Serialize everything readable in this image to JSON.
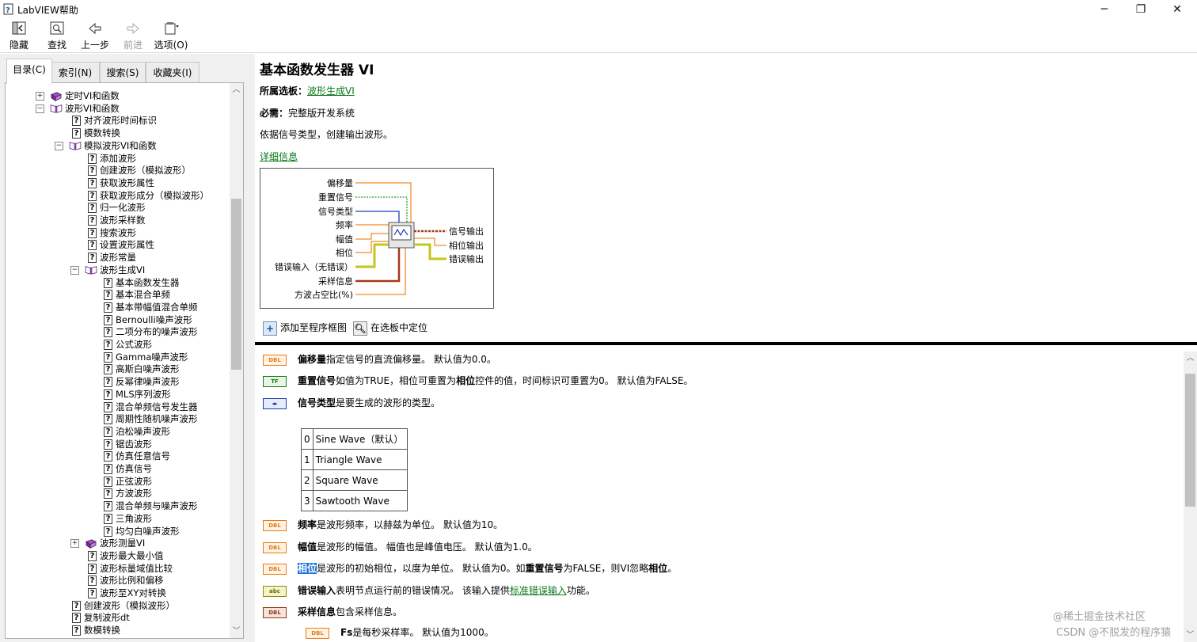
{
  "window": {
    "title": "LabVIEW帮助"
  },
  "toolbar": {
    "hide": "隐藏",
    "find": "查找",
    "back": "上一步",
    "forward": "前进",
    "options": "选项(O)"
  },
  "tabs": [
    "目录(C)",
    "索引(N)",
    "搜索(S)",
    "收藏夹(I)"
  ],
  "tree": [
    "定时VI和函数",
    "波形VI和函数",
    "对齐波形时间标识",
    "模数转换",
    "模拟波形VI和函数",
    "添加波形",
    "创建波形（模拟波形）",
    "获取波形属性",
    "获取波形成分（模拟波形）",
    "归一化波形",
    "波形采样数",
    "搜索波形",
    "设置波形属性",
    "波形常量",
    "波形生成VI",
    "基本函数发生器",
    "基本混合单频",
    "基本带幅值混合单频",
    "Bernoulli噪声波形",
    "二项分布的噪声波形",
    "公式波形",
    "Gamma噪声波形",
    "高斯白噪声波形",
    "反幂律噪声波形",
    "MLS序列波形",
    "混合单频信号发生器",
    "周期性随机噪声波形",
    "泊松噪声波形",
    "锯齿波形",
    "仿真任意信号",
    "仿真信号",
    "正弦波形",
    "方波波形",
    "混合单频与噪声波形",
    "三角波形",
    "均匀白噪声波形",
    "波形测量VI",
    "波形最大最小值",
    "波形标量域值比较",
    "波形比例和偏移",
    "波形至XY对转换",
    "创建波形（模拟波形）",
    "复制波形dt",
    "数模转换"
  ],
  "content": {
    "title": "基本函数发生器 VI",
    "palette_label": "所属选板：",
    "palette_link": "波形生成VI",
    "requires_label": "必需：",
    "requires_value": "完整版开发系统",
    "description": "依据信号类型，创建输出波形。",
    "details_link": "详细信息",
    "inputs": [
      "偏移量",
      "重置信号",
      "信号类型",
      "频率",
      "幅值",
      "相位",
      "错误输入（无错误）",
      "采样信息",
      "方波占空比(%)"
    ],
    "outputs": [
      "信号输出",
      "相位输出",
      "错误输出"
    ],
    "add_to_diagram": "添加至程序框图",
    "locate_in_palette": "在选板中定位"
  },
  "params": {
    "offset": {
      "name": "偏移量",
      "text": "指定信号的直流偏移量。 默认值为0.0。",
      "term": "DBL"
    },
    "reset": {
      "name": "重置信号",
      "t1": "如值为TRUE，相位可重置为",
      "b1": "相位",
      "t2": "控件的值，时间标识可重置为0。 默认值为FALSE。",
      "term": "TF"
    },
    "type": {
      "name": "信号类型",
      "text": "是要生成的波形的类型。",
      "term": "◂▸"
    },
    "enum": [
      {
        "idx": "0",
        "label": "Sine Wave（默认）"
      },
      {
        "idx": "1",
        "label": "Triangle Wave"
      },
      {
        "idx": "2",
        "label": "Square Wave"
      },
      {
        "idx": "3",
        "label": "Sawtooth Wave"
      }
    ],
    "freq": {
      "name": "频率",
      "text": "是波形频率，以赫兹为单位。 默认值为10。",
      "term": "DBL"
    },
    "amp": {
      "name": "幅值",
      "text": "是波形的幅值。 幅值也是峰值电压。 默认值为1.0。",
      "term": "DBL"
    },
    "phase": {
      "name": "相位",
      "t1": "是波形的初始相位，以度为单位。 默认值为0。如",
      "b1": "重置信号",
      "t2": "为FALSE，则VI忽略",
      "b2": "相位",
      "t3": "。",
      "term": "DBL"
    },
    "err": {
      "name": "错误输入",
      "t1": "表明节点运行前的错误情况。 该输入提供",
      "link": "标准错误输入",
      "t2": "功能。",
      "term": "abc"
    },
    "sample": {
      "name": "采样信息",
      "text": "包含采样信息。",
      "term": "DBL"
    },
    "fs": {
      "name": "Fs",
      "text": "是每秒采样率。 默认值为1000。",
      "term": "DBL"
    }
  },
  "watermark": {
    "line1": "@稀土掘金技术社区",
    "line2": "CSDN @不脱发的程序猿"
  }
}
